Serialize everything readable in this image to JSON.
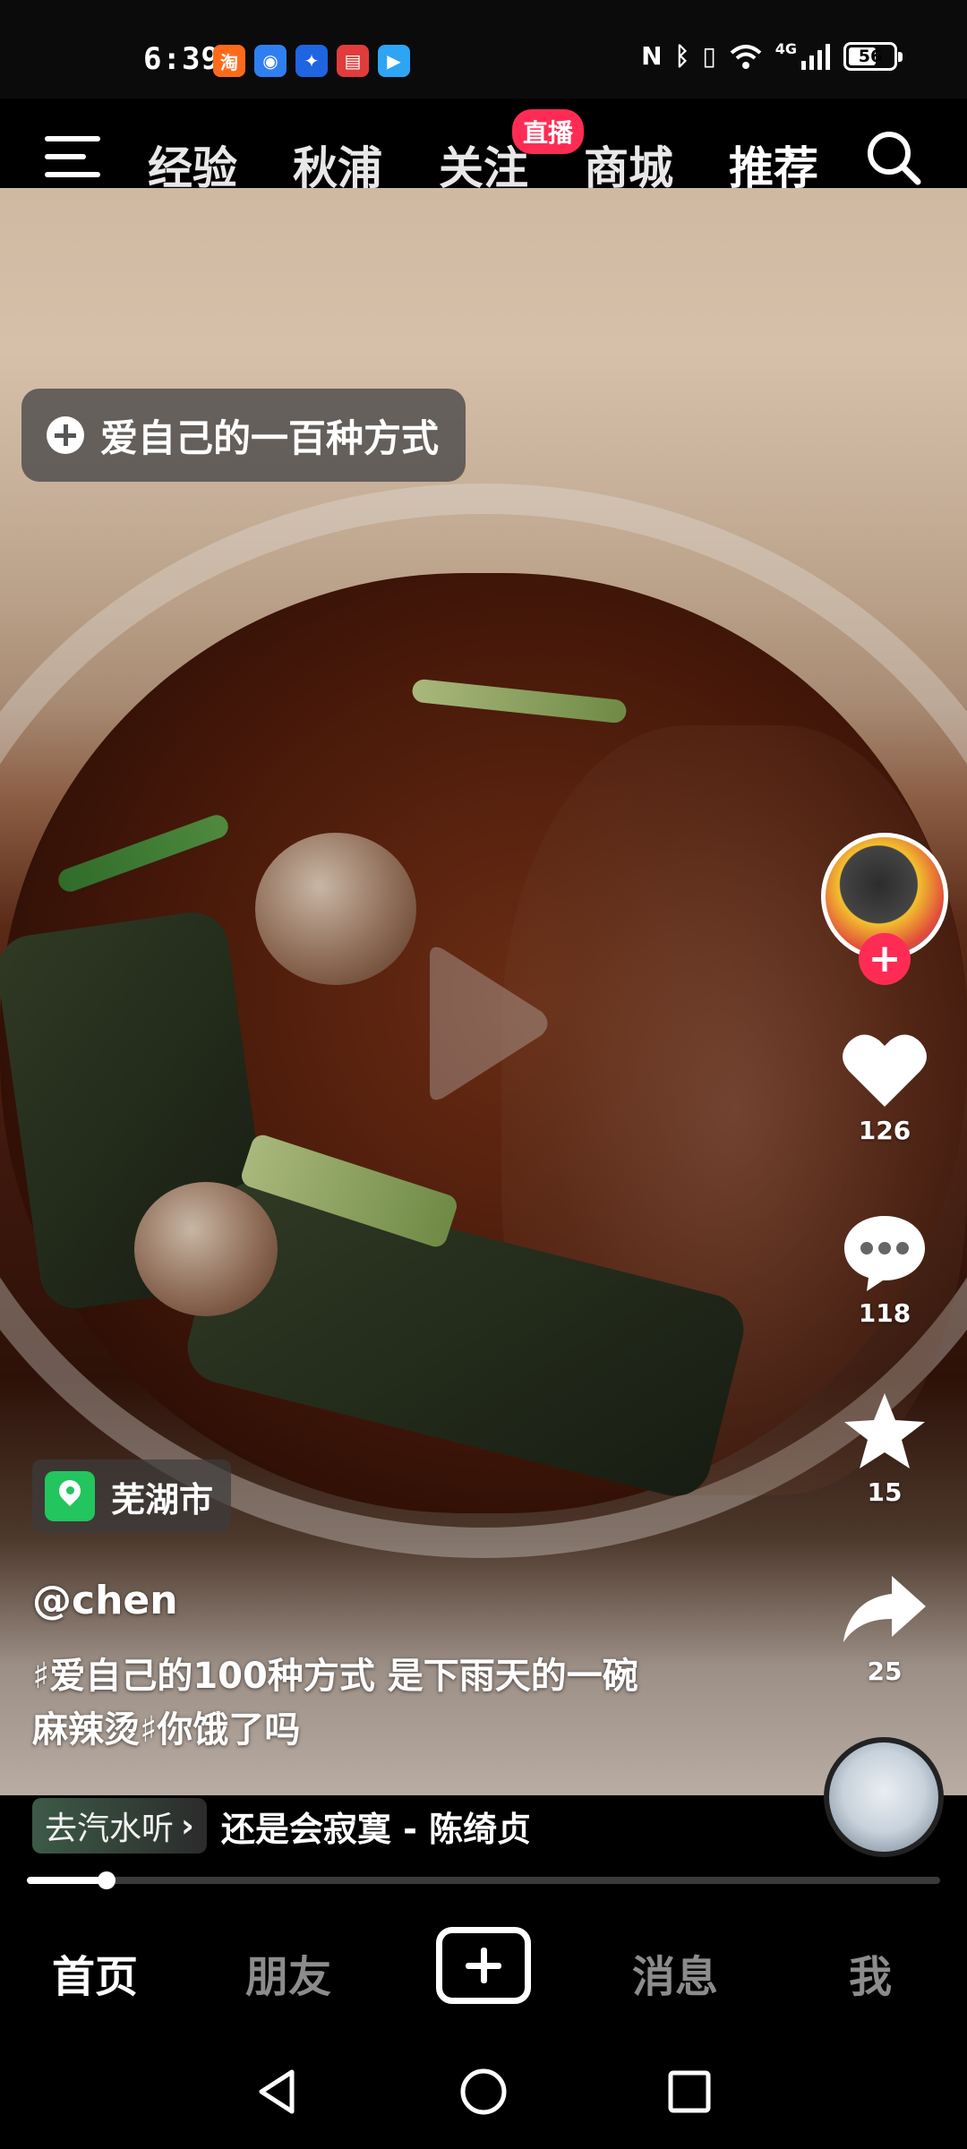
{
  "status_bar": {
    "time": "6:39",
    "app_icons": [
      {
        "name": "taobao-icon",
        "glyph": "淘",
        "color": "#ff6a1a"
      },
      {
        "name": "browser-icon",
        "glyph": "◉",
        "color": "#2f7ff0"
      },
      {
        "name": "bulb-app-icon",
        "glyph": "✦",
        "color": "#1f64e0"
      },
      {
        "name": "book-app-icon",
        "glyph": "▤",
        "color": "#e03c3c"
      },
      {
        "name": "video-app-icon",
        "glyph": "▶",
        "color": "#2ea4f5"
      }
    ],
    "network": "4G",
    "battery": "56",
    "battery_level": 0.56
  },
  "top_nav": {
    "tabs": [
      "经验",
      "秋浦",
      "关注",
      "商城",
      "推荐"
    ],
    "active_tab": "推荐",
    "live_badge": "直播"
  },
  "video": {
    "topic": "爱自己的一百种方式",
    "location": "芜湖市",
    "username": "@chen",
    "caption_line1": "♯爱自己的100种方式 是下雨天的一碗",
    "caption_line2": "麻辣烫♯你饿了吗",
    "music_chip": "去汽水听",
    "music_chip_arrow": "›",
    "music_title": "还是会寂寞 - 陈绮贞",
    "progress": 0.087
  },
  "actions": {
    "likes": "126",
    "comments": "118",
    "favorites": "15",
    "shares": "25",
    "follow_plus": "+"
  },
  "bottom_nav": {
    "home": "首页",
    "friends": "朋友",
    "messages": "消息",
    "me": "我"
  },
  "colors": {
    "accent_red": "#fe2c55",
    "location_green": "#22c55e"
  }
}
